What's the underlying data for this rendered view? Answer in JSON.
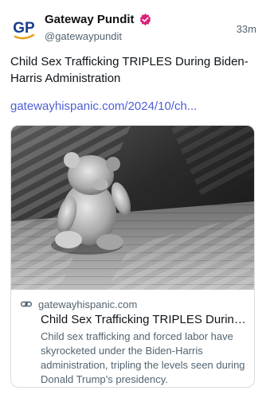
{
  "author": {
    "display_name": "Gateway Pundit",
    "handle": "@gatewaypundit",
    "avatar_initials": "GP",
    "avatar_colors": {
      "letters": "#1a3e8c",
      "swoosh": "#e8a21c"
    },
    "verified_badge_color": "#d6247a",
    "icons": {
      "avatar": "gateway-pundit-logo",
      "verified": "verified-badge-icon"
    }
  },
  "post": {
    "time": "33m",
    "text": "Child Sex Trafficking TRIPLES During Biden-Harris Administration",
    "link_text": "gatewayhispanic.com/2024/10/ch..."
  },
  "card": {
    "domain": "gatewayhispanic.com",
    "title": "Child Sex Trafficking TRIPLES During Biden-Harris Administration",
    "description": "Child sex trafficking and forced labor have skyrocketed under the Biden-Harris administration, tripling the levels seen during Donald Trump’s presidency.",
    "image_subject": "black-and-white photo of a teddy bear sitting on a wooden floor in window-blind shadows",
    "icons": {
      "domain": "link-icon"
    }
  },
  "colors": {
    "link": "#4f5fd6",
    "secondary_text": "#536471",
    "border": "#d9dde1"
  }
}
